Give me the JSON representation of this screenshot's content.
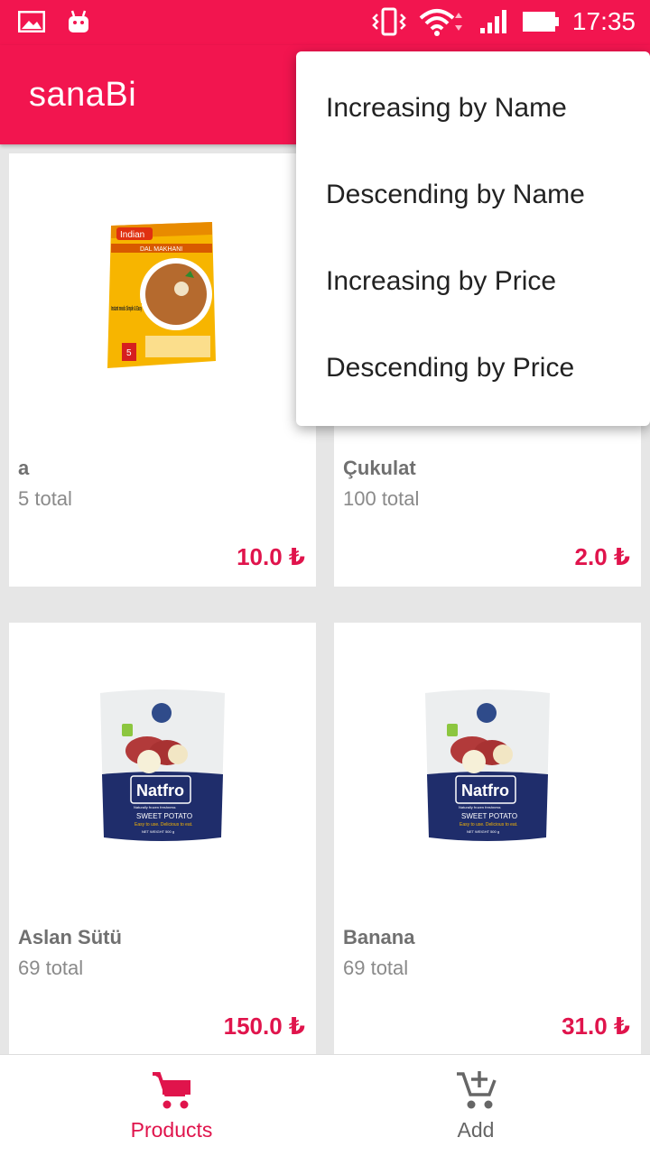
{
  "status_bar": {
    "time": "17:35",
    "icons": [
      "gallery-icon",
      "android-icon",
      "vibrate-icon",
      "wifi-icon",
      "signal-icon",
      "battery-icon"
    ]
  },
  "app_bar": {
    "title": "sanaBi"
  },
  "sort_menu": {
    "items": [
      "Increasing by Name",
      "Descending by Name",
      "Increasing by Price",
      "Descending by Price"
    ]
  },
  "products": [
    {
      "name": "a",
      "total": "5 total",
      "price": "10.0 ₺",
      "image": "instant-meal-package"
    },
    {
      "name": "Çukulat",
      "total": "100 total",
      "price": "2.0 ₺",
      "image": "hidden-behind-menu"
    },
    {
      "name": "Aslan Sütü",
      "total": "69 total",
      "price": "150.0 ₺",
      "image": "sweet-potato-package"
    },
    {
      "name": "Banana",
      "total": "69 total",
      "price": "31.0 ₺",
      "image": "sweet-potato-package"
    }
  ],
  "bottom_nav": {
    "items": [
      {
        "label": "Products",
        "icon": "cart-icon",
        "active": true
      },
      {
        "label": "Add",
        "icon": "add-to-cart-icon",
        "active": false
      }
    ]
  },
  "colors": {
    "primary": "#f2154f",
    "price": "#e0144c",
    "nav_inactive": "#666666"
  },
  "package_text": {
    "brand_meal": "Indian",
    "meal_name": "DAL MAKHANI",
    "meal_tagline": "Instant meals Simple & Easy",
    "brand_potato": "Natfro",
    "potato_tagline": "Naturally frozen freshness",
    "potato_name": "SWEET POTATO",
    "potato_sub": "Easy to use. Delicious to eat.",
    "potato_weight": "NET WEIGHT 500 g"
  }
}
